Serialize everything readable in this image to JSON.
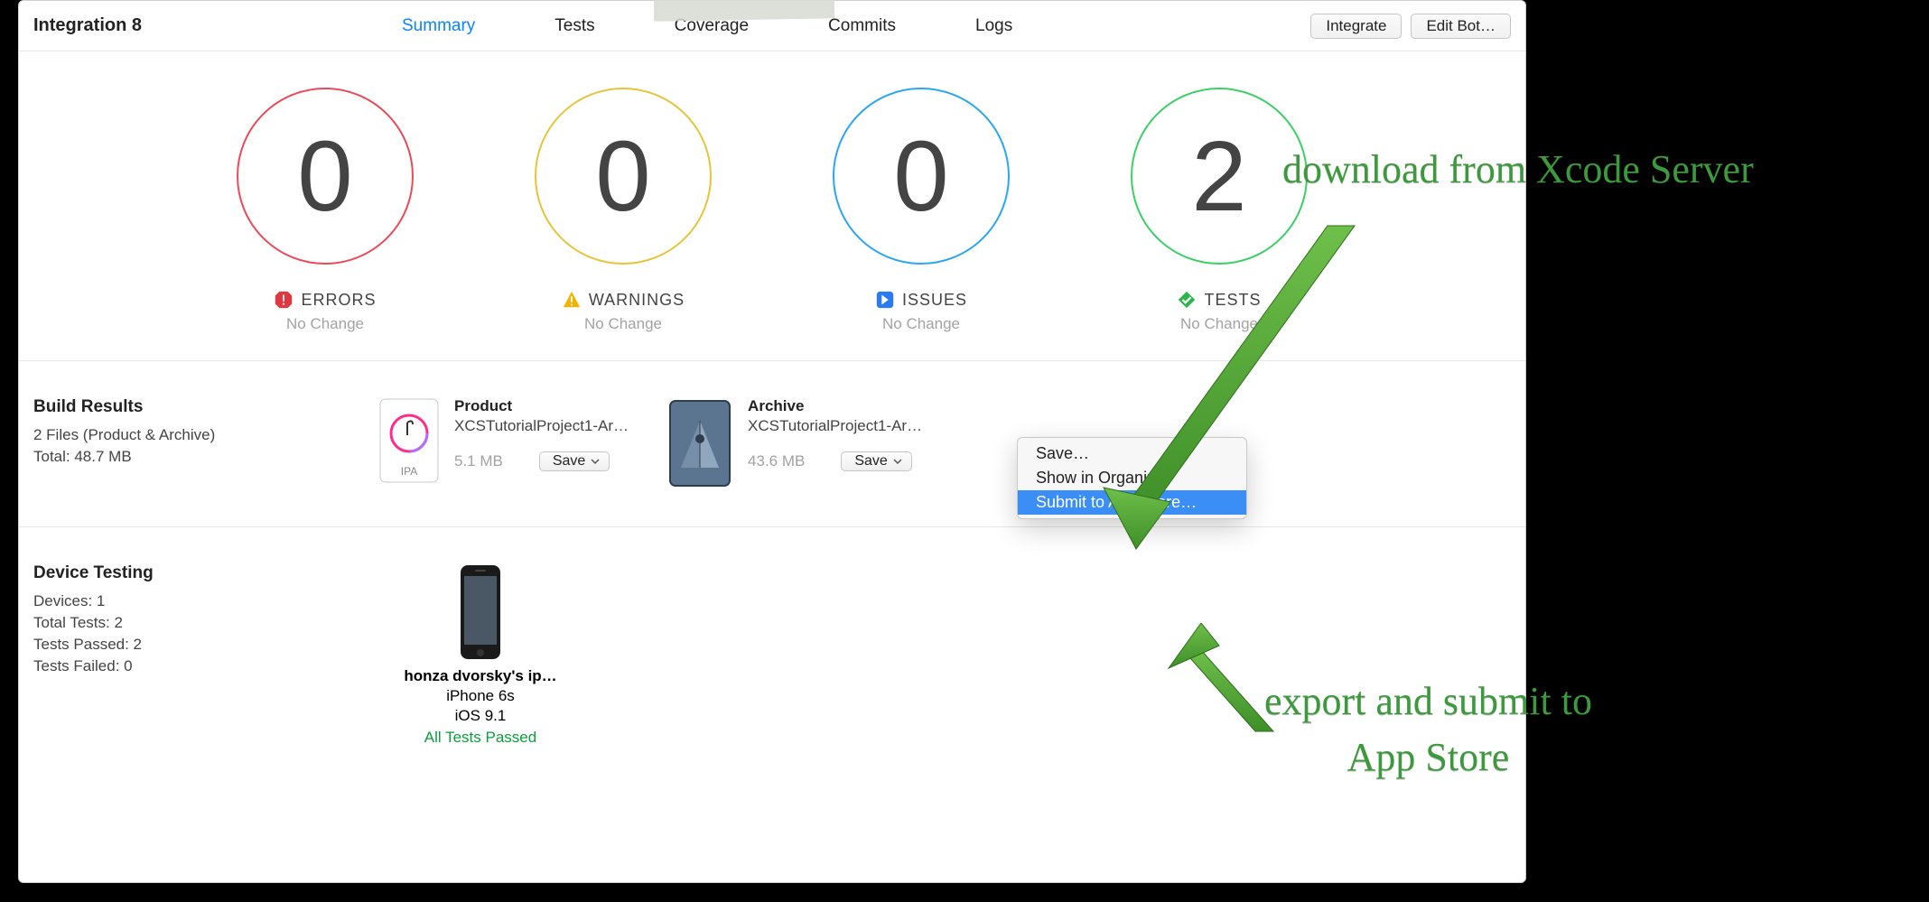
{
  "header": {
    "title": "Integration 8",
    "tabs": {
      "summary": "Summary",
      "tests": "Tests",
      "coverage": "Coverage",
      "commits": "Commits",
      "logs": "Logs"
    },
    "integrate_btn": "Integrate",
    "edit_bot_btn": "Edit Bot…"
  },
  "stats": {
    "errors": {
      "value": "0",
      "label": "ERRORS",
      "sub": "No Change"
    },
    "warnings": {
      "value": "0",
      "label": "WARNINGS",
      "sub": "No Change"
    },
    "issues": {
      "value": "0",
      "label": "ISSUES",
      "sub": "No Change"
    },
    "tests": {
      "value": "2",
      "label": "TESTS",
      "sub": "No Change"
    }
  },
  "build": {
    "heading": "Build Results",
    "line1": "2 Files (Product & Archive)",
    "line2": "Total: 48.7 MB",
    "product": {
      "title": "Product",
      "name": "XCSTutorialProject1-Ar…",
      "size": "5.1 MB",
      "save": "Save",
      "icon_label": "IPA"
    },
    "archive": {
      "title": "Archive",
      "name": "XCSTutorialProject1-Ar…",
      "size": "43.6 MB",
      "save": "Save"
    }
  },
  "dropdown": {
    "save": "Save…",
    "organizer": "Show in Organizer",
    "submit": "Submit to App Store…"
  },
  "device": {
    "heading": "Device Testing",
    "lines": {
      "devices": "Devices: 1",
      "total": "Total Tests: 2",
      "passed": "Tests Passed: 2",
      "failed": "Tests Failed: 0"
    },
    "card": {
      "name": "honza dvorsky's ip…",
      "model": "iPhone 6s",
      "os": "iOS 9.1",
      "status": "All Tests Passed"
    }
  },
  "annotations": {
    "a1": "download from Xcode Server",
    "a2_line1": "export and submit to",
    "a2_line2": "App Store"
  }
}
